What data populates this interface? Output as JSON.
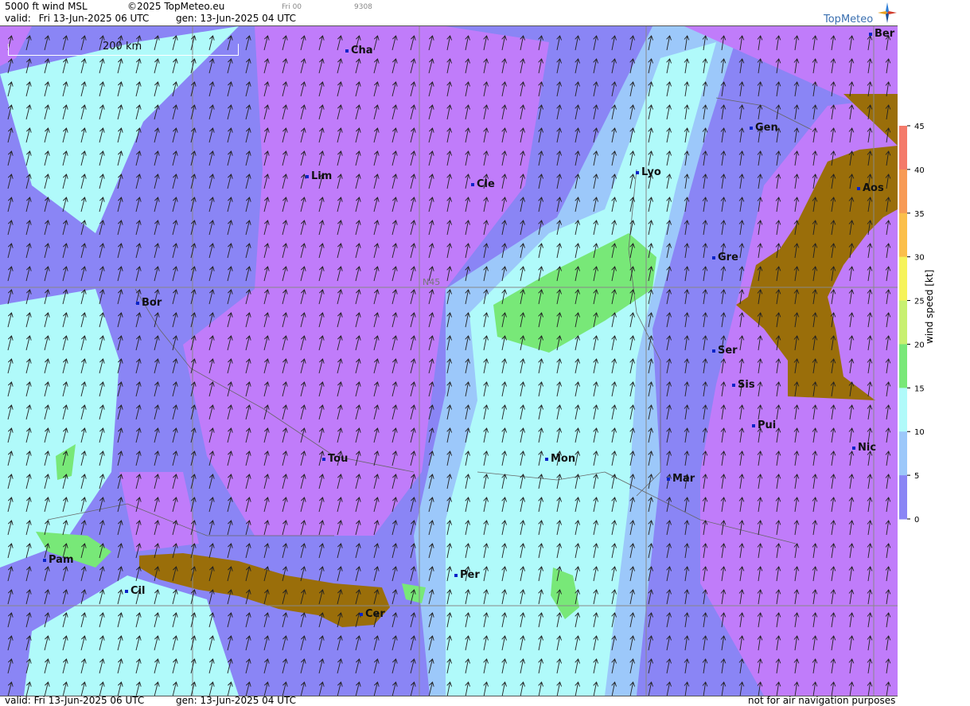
{
  "header": {
    "title": "5000 ft wind MSL",
    "copyright": "©2025 TopMeteo.eu",
    "run": "Fri 00",
    "code": "9308",
    "valid_label": "valid:",
    "valid_value": "Fri  13-Jun-2025  06 UTC",
    "gen_label": "gen:",
    "gen_value": "13-Jun-2025 04 UTC",
    "brand": "TopMeteo"
  },
  "footer": {
    "valid": "valid:  Fri  13-Jun-2025  06 UTC",
    "gen": "gen: 13-Jun-2025 04 UTC",
    "disclaimer": "not for air navigation purposes"
  },
  "scale_bar": {
    "label": "200 km"
  },
  "grid_label": "N45",
  "cities": [
    {
      "name": "Cha"
    },
    {
      "name": "Ber"
    },
    {
      "name": "Gen"
    },
    {
      "name": "Lim"
    },
    {
      "name": "Cle"
    },
    {
      "name": "Lyo"
    },
    {
      "name": "Aos"
    },
    {
      "name": "Gre"
    },
    {
      "name": "Bor"
    },
    {
      "name": "Ser"
    },
    {
      "name": "Sis"
    },
    {
      "name": "Pui"
    },
    {
      "name": "Nic"
    },
    {
      "name": "Tou"
    },
    {
      "name": "Mon"
    },
    {
      "name": "Mar"
    },
    {
      "name": "Pam"
    },
    {
      "name": "Cil"
    },
    {
      "name": "Per"
    },
    {
      "name": "Cer"
    }
  ],
  "legend": {
    "title": "wind speed [kt]",
    "ticks": [
      "45",
      "40",
      "35",
      "30",
      "25",
      "20",
      "15",
      "10",
      "5",
      "0"
    ],
    "colors": [
      "#f47a6a",
      "#f79a55",
      "#fbbf4a",
      "#f6f35a",
      "#c8f070",
      "#78e878",
      "#b0fafa",
      "#9cc8fa",
      "#8a85f5",
      "#c07cfa"
    ]
  }
}
